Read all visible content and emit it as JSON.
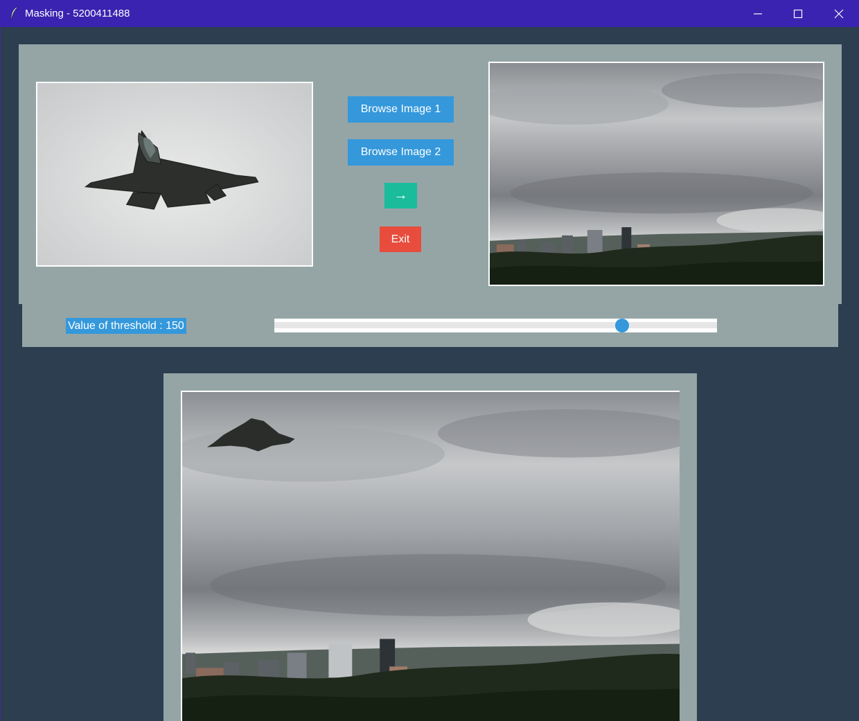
{
  "window": {
    "title": "Masking - 5200411488",
    "controls": [
      "minimize-icon",
      "maximize-icon",
      "close-icon"
    ]
  },
  "buttons": {
    "browse1": "Browse Image 1",
    "browse2": "Browse Image 2",
    "process": "→",
    "exit": "Exit"
  },
  "threshold": {
    "label": "Value of threshold : 150",
    "value": 150,
    "slider_fraction": 0.79
  },
  "colors": {
    "background": "#2c3e50",
    "panel": "#95a5a6",
    "browse_button": "#3498db",
    "process_button": "#1abc9c",
    "exit_button": "#e74c3c",
    "titlebar": "#3a23b0"
  }
}
